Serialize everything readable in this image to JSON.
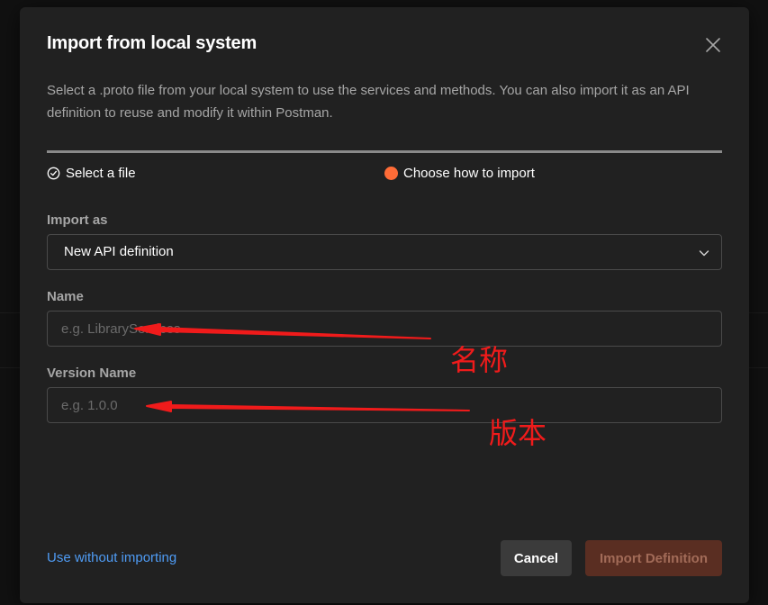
{
  "dialog": {
    "title": "Import from local system",
    "description": "Select a .proto file from your local system to use the services and methods. You can also import it as an API definition to reuse and modify it within Postman."
  },
  "steps": [
    {
      "label": "Select a file",
      "status": "completed",
      "icon": "check-circle-icon"
    },
    {
      "label": "Choose how to import",
      "status": "current",
      "icon": "orange-dot"
    }
  ],
  "form": {
    "import_as": {
      "label": "Import as",
      "value": "New API definition"
    },
    "name": {
      "label": "Name",
      "placeholder": "e.g. LibraryServices",
      "value": ""
    },
    "version_name": {
      "label": "Version Name",
      "placeholder": "e.g. 1.0.0",
      "value": ""
    }
  },
  "footer": {
    "link": "Use without importing",
    "cancel": "Cancel",
    "import": "Import Definition"
  },
  "annotations": {
    "name_note": "名称",
    "version_note": "版本"
  },
  "colors": {
    "accent": "#ff6c37",
    "link": "#4f9cf5",
    "annotation": "#f01b1b",
    "modal_bg": "#212121"
  }
}
